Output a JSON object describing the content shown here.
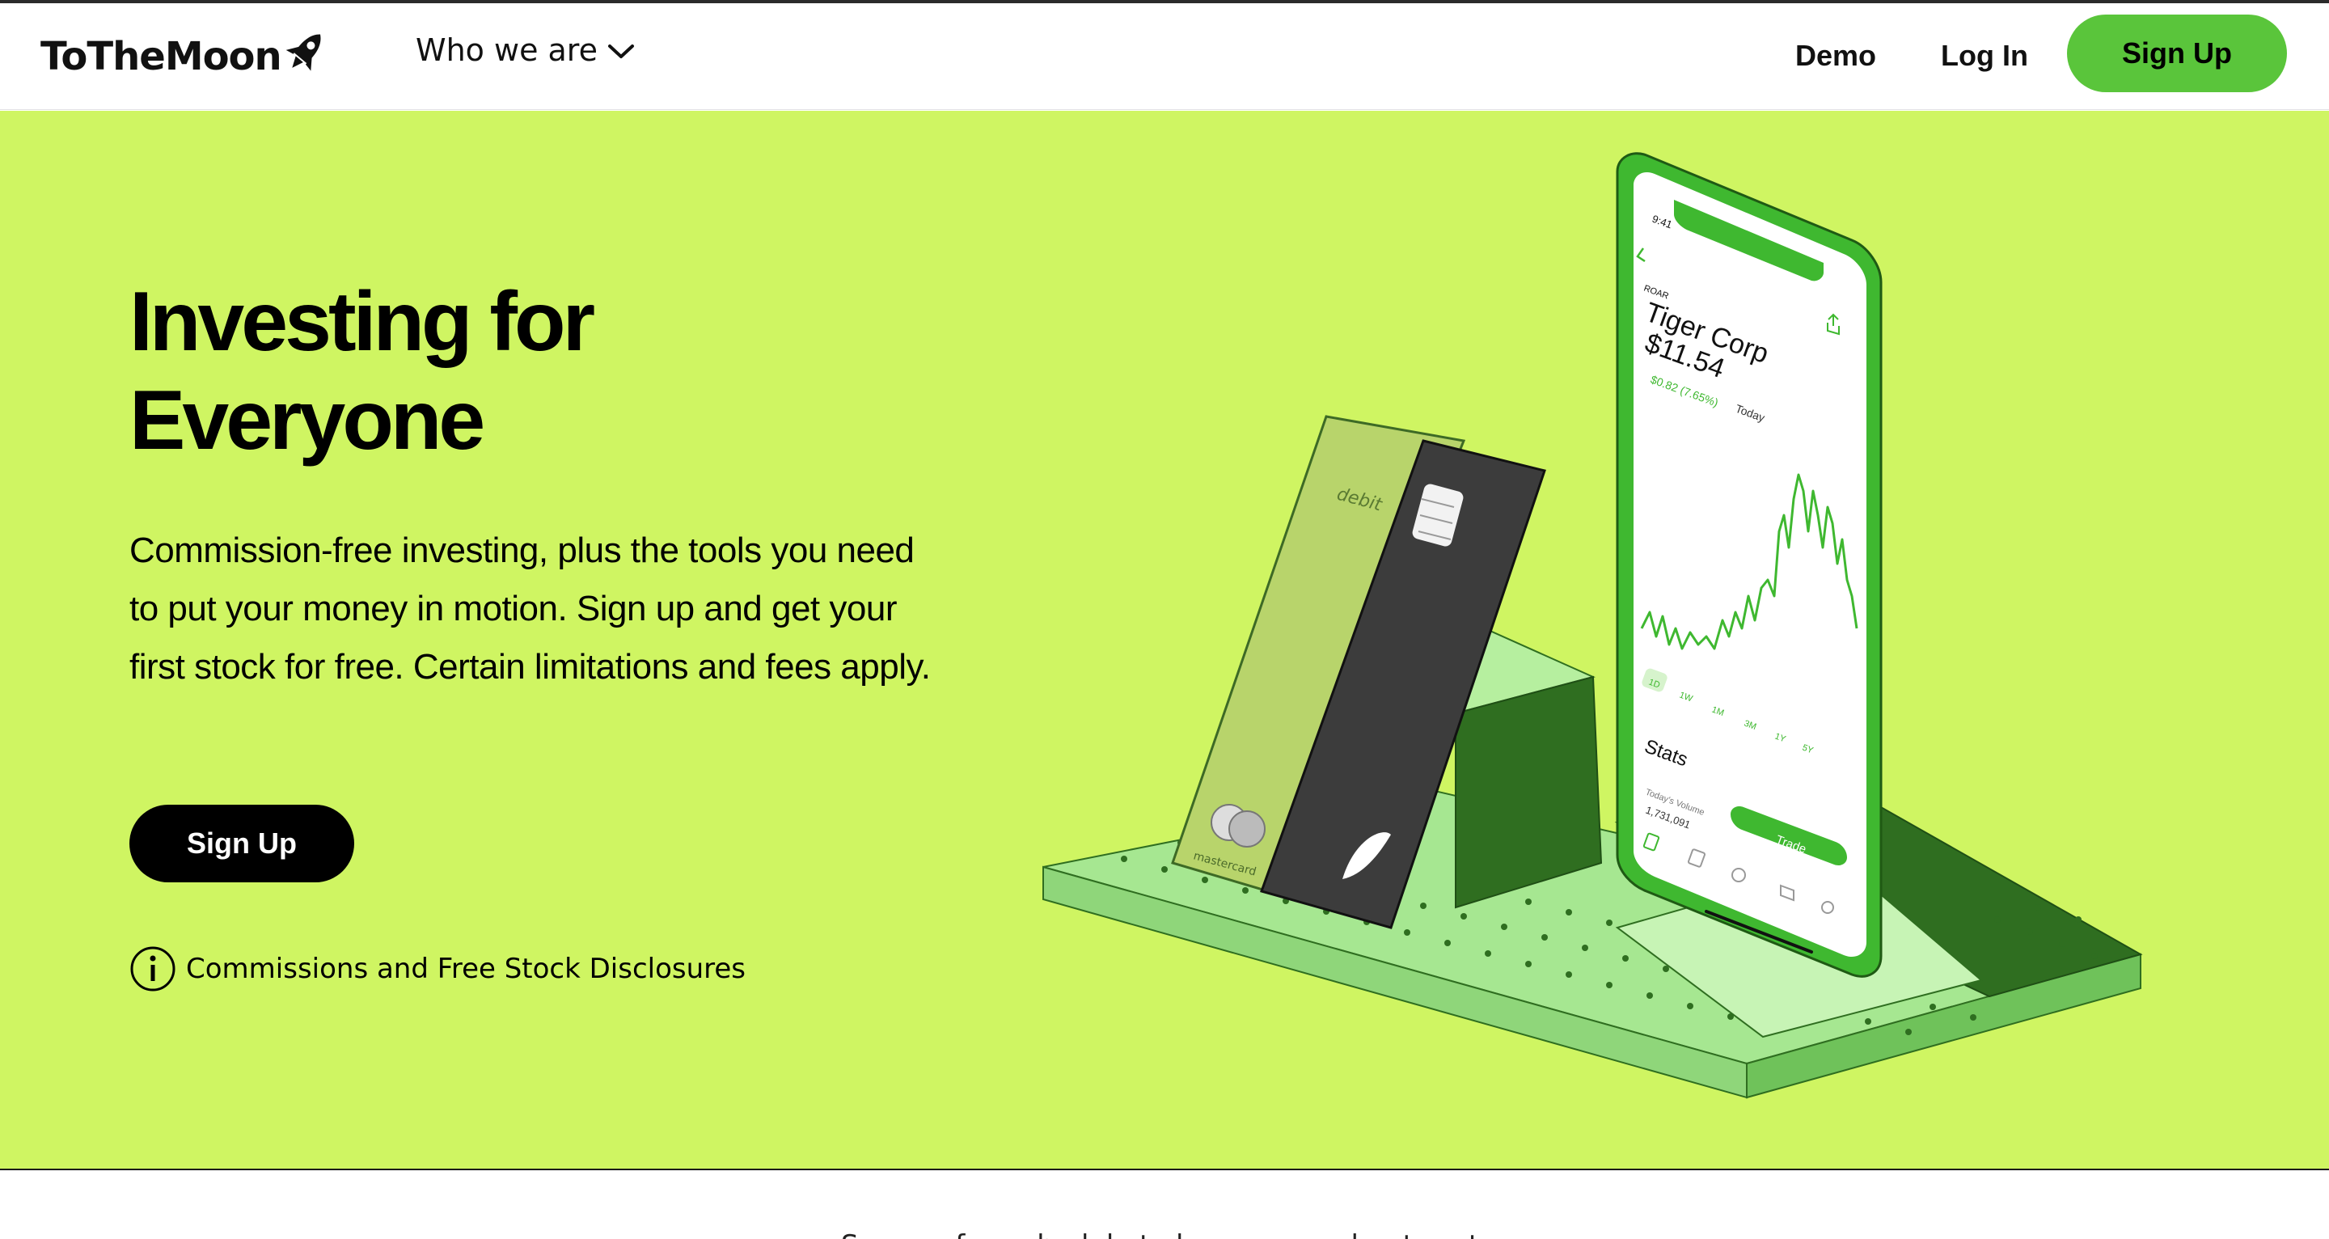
{
  "brand": {
    "name": "ToTheMoon",
    "icon": "rocket-icon"
  },
  "nav": {
    "who_we_are": "Who we are",
    "demo": "Demo",
    "login": "Log In",
    "signup": "Sign Up"
  },
  "hero": {
    "title_line1": "Investing for",
    "title_line2": "Everyone",
    "body": "Commission-free investing, plus the tools you need to put your money in motion. Sign up and get your first stock for free. Certain limitations and fees apply.",
    "signup": "Sign Up",
    "disclosure": "Commissions and Free Stock Disclosures"
  },
  "phone": {
    "time": "9:41",
    "ticker": "ROAR",
    "company": "Tiger Corp",
    "price": "$11.54",
    "change": "$0.82 (7.65%)",
    "change_period": "Today",
    "ranges": [
      "1D",
      "1W",
      "1M",
      "3M",
      "1Y",
      "5Y"
    ],
    "stats_title": "Stats",
    "volume_label": "Today's Volume",
    "volume_value": "1,731,091",
    "trade_button": "Trade"
  },
  "card": {
    "type_label": "debit",
    "network_label": "mastercard"
  },
  "footer_note": "See our fee schedule to learn more about cost.",
  "colors": {
    "hero_bg": "#cff562",
    "accent_green": "#5ac53b",
    "dark_green": "#2f6e20",
    "black": "#000000"
  }
}
